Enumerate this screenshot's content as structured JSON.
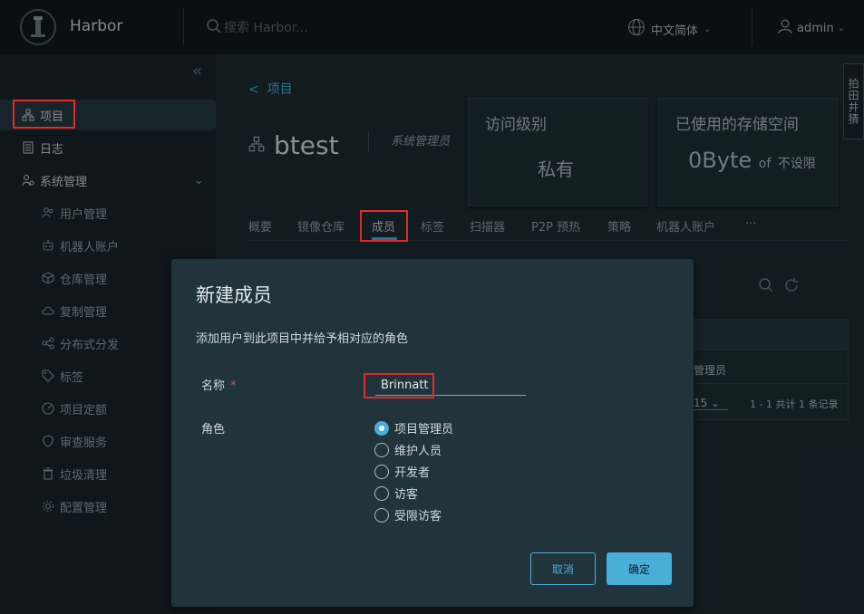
{
  "header": {
    "app_title": "Harbor",
    "search_placeholder": "搜索 Harbor...",
    "language": "中文简体",
    "user": "admin"
  },
  "sidebar": {
    "items": [
      {
        "label": "项目",
        "icon": "projects-icon"
      },
      {
        "label": "日志",
        "icon": "logs-icon"
      },
      {
        "label": "系统管理",
        "icon": "admin-icon"
      }
    ],
    "sub_items": [
      {
        "label": "用户管理",
        "icon": "users-icon"
      },
      {
        "label": "机器人账户",
        "icon": "robot-icon"
      },
      {
        "label": "仓库管理",
        "icon": "registry-icon"
      },
      {
        "label": "复制管理",
        "icon": "cloud-icon"
      },
      {
        "label": "分布式分发",
        "icon": "share-icon"
      },
      {
        "label": "标签",
        "icon": "tag-icon"
      },
      {
        "label": "项目定额",
        "icon": "quota-icon"
      },
      {
        "label": "审查服务",
        "icon": "shield-icon"
      },
      {
        "label": "垃圾清理",
        "icon": "trash-icon"
      },
      {
        "label": "配置管理",
        "icon": "gear-icon"
      }
    ]
  },
  "main": {
    "breadcrumb": "项目",
    "project_name": "btest",
    "project_role": "系统管理员",
    "access_card": {
      "title": "访问级别",
      "value": "私有"
    },
    "storage_card": {
      "title": "已使用的存储空间",
      "used": "0Byte",
      "of": "of",
      "limit": "不设限"
    },
    "tabs": [
      "概要",
      "镜像仓库",
      "成员",
      "标签",
      "扫描器",
      "P2P 预热",
      "策略",
      "机器人账户",
      "···"
    ],
    "active_tab": "成员",
    "table": {
      "cell": "管理员",
      "page_size": "15",
      "page_info": "1 - 1 共计 1 条记录"
    }
  },
  "side_tab": "拍田井猜",
  "modal": {
    "title": "新建成员",
    "description": "添加用户到此项目中并给予相对应的角色",
    "name_label": "名称",
    "required_mark": "*",
    "name_value": "Brinnatt",
    "role_label": "角色",
    "roles": [
      "项目管理员",
      "维护人员",
      "开发者",
      "访客",
      "受限访客"
    ],
    "selected_role": "项目管理员",
    "cancel_label": "取消",
    "ok_label": "确定"
  },
  "colors": {
    "accent": "#4aaed9",
    "highlight_box": "#e12b2b"
  }
}
